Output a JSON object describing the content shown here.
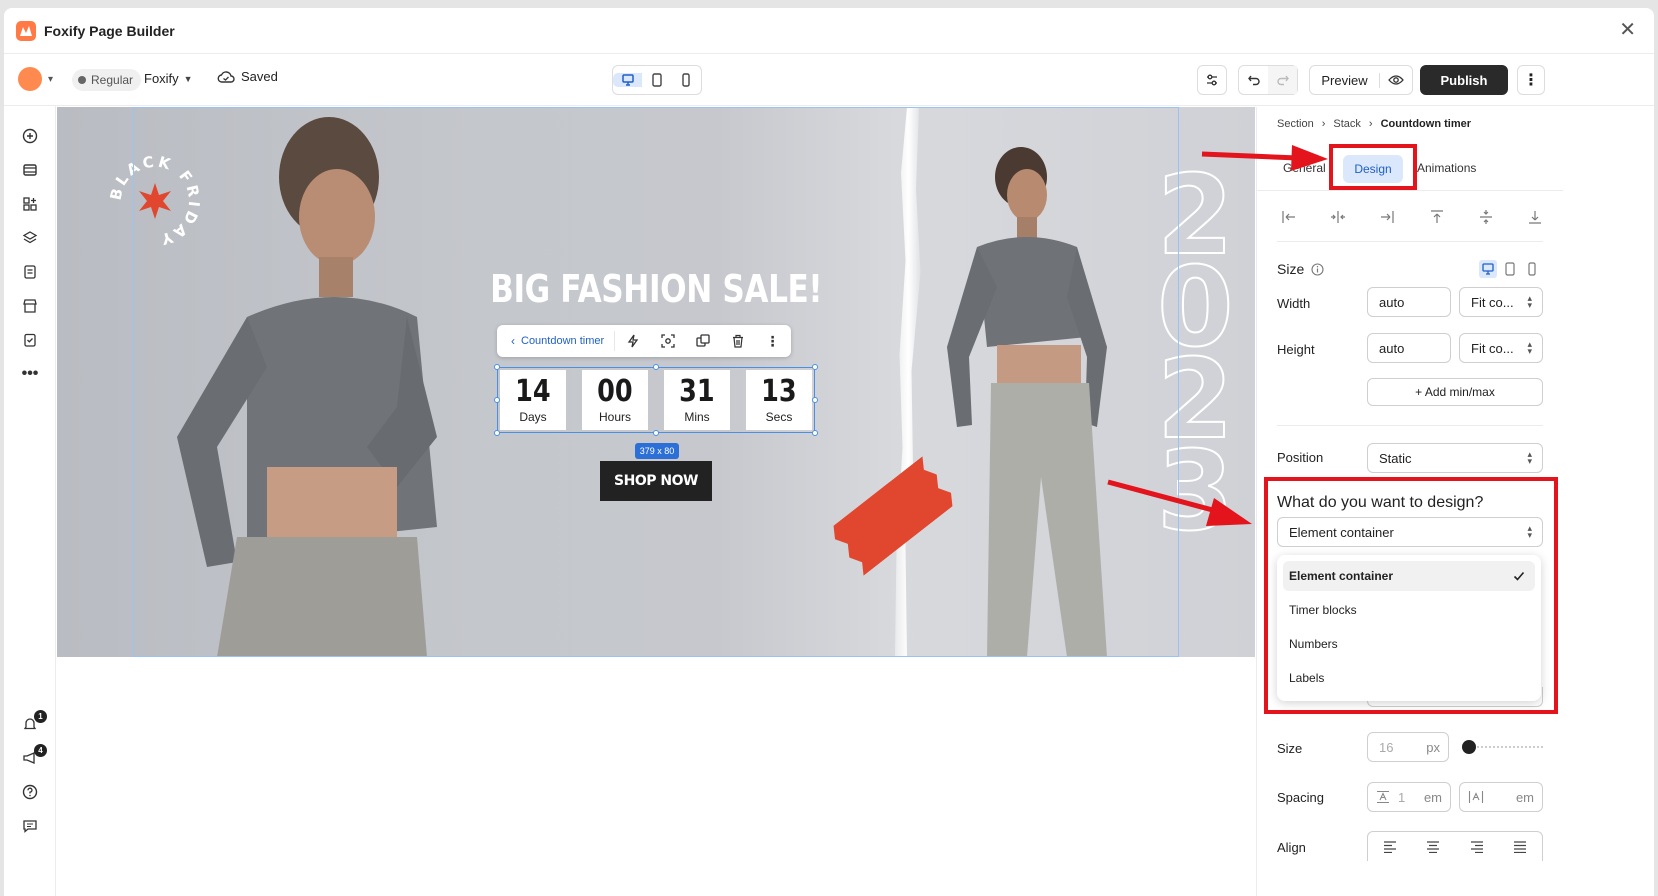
{
  "app": {
    "title": "Foxify Page Builder"
  },
  "toolbar": {
    "plan": "Regular",
    "store": "Foxify",
    "status": "Saved",
    "preview_label": "Preview",
    "publish_label": "Publish"
  },
  "rail": {
    "notifications_count": "1",
    "announcements_count": "4"
  },
  "canvas": {
    "badge_text": "BLACK FRIDAY",
    "year_digits": [
      "2",
      "0",
      "2",
      "3"
    ],
    "headline": "BIG FASHION SALE!",
    "context_toolbar": {
      "back_label": "Countdown timer"
    },
    "timer": [
      {
        "value": "14",
        "label": "Days"
      },
      {
        "value": "00",
        "label": "Hours"
      },
      {
        "value": "31",
        "label": "Mins"
      },
      {
        "value": "13",
        "label": "Secs"
      }
    ],
    "dimension_badge": "379 x 80",
    "cta_label": "SHOP NOW"
  },
  "panel": {
    "breadcrumb": [
      "Section",
      "Stack",
      "Countdown timer"
    ],
    "tabs": [
      "General",
      "Design",
      "Animations"
    ],
    "active_tab": "Design",
    "size_label": "Size",
    "width_label": "Width",
    "width_value": "auto",
    "width_mode": "Fit co...",
    "height_label": "Height",
    "height_value": "auto",
    "height_mode": "Fit co...",
    "add_minmax_label": "+ Add min/max",
    "position_label": "Position",
    "position_value": "Static",
    "design_question": "What do you want to design?",
    "design_target": "Element container",
    "dropdown_options": [
      "Element container",
      "Timer blocks",
      "Numbers",
      "Labels"
    ],
    "font_size_label": "Size",
    "font_size_value": "16",
    "font_size_unit": "px",
    "spacing_label": "Spacing",
    "line_spacing_value": "1",
    "spacing_unit": "em",
    "letter_spacing_unit": "em",
    "align_label": "Align"
  },
  "colors": {
    "accent_blue": "#1f5fc9",
    "annotation_red": "#e3141b",
    "publish_bg": "#2a2a2a",
    "tape_red": "#e1472e"
  }
}
